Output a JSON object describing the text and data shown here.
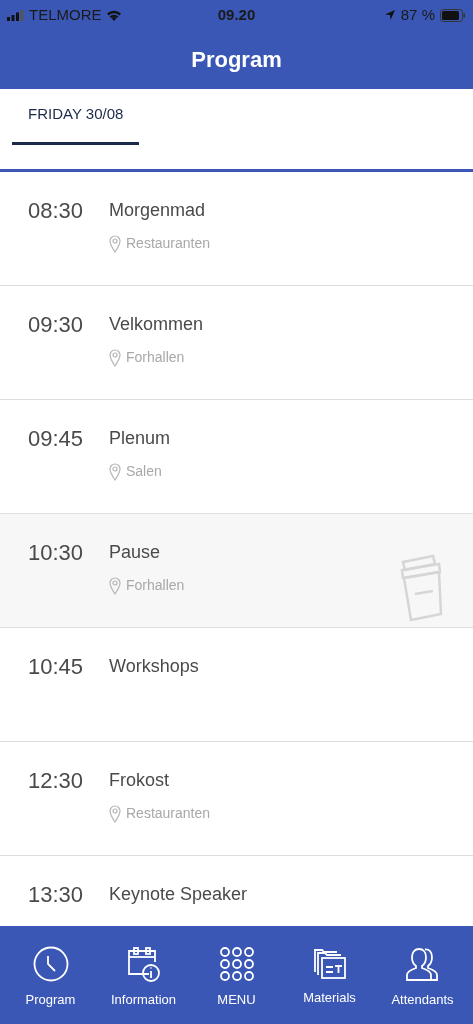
{
  "status_bar": {
    "carrier": "TELMORE",
    "time": "09.20",
    "battery": "87 %"
  },
  "header": {
    "title": "Program"
  },
  "day_tabs": [
    {
      "label": "FRIDAY 30/08",
      "selected": true
    }
  ],
  "sessions": [
    {
      "time": "08:30",
      "title": "Morgenmad",
      "location": "Restauranten",
      "kind": "session"
    },
    {
      "time": "09:30",
      "title": "Velkommen",
      "location": "Forhallen",
      "kind": "session"
    },
    {
      "time": "09:45",
      "title": "Plenum",
      "location": "Salen",
      "kind": "session"
    },
    {
      "time": "10:30",
      "title": "Pause",
      "location": "Forhallen",
      "kind": "break"
    },
    {
      "time": "10:45",
      "title": "Workshops",
      "kind": "session"
    },
    {
      "time": "12:30",
      "title": "Frokost",
      "location": "Restauranten",
      "kind": "session"
    },
    {
      "time": "13:30",
      "title": "Keynote Speaker",
      "kind": "session"
    }
  ],
  "tab_bar": [
    {
      "label": "Program",
      "kind": "clock"
    },
    {
      "label": "Information",
      "kind": "calendar-info"
    },
    {
      "label": "MENU",
      "kind": "grid"
    },
    {
      "label": "Materials",
      "kind": "folder"
    },
    {
      "label": "Attendants",
      "kind": "people"
    }
  ]
}
